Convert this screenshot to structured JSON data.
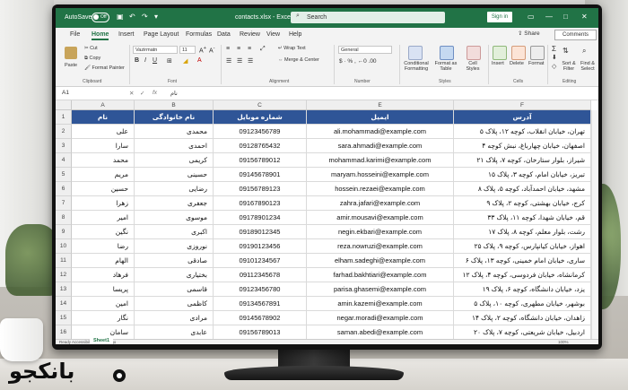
{
  "titlebar": {
    "autosave_label": "AutoSave",
    "autosave_state": "Off",
    "doc_title": "contacts.xlsx  -  Excel",
    "search_placeholder": "Search",
    "signin_label": "Sign in"
  },
  "menu": {
    "tabs": [
      "File",
      "Home",
      "Insert",
      "Page Layout",
      "Formulas",
      "Data",
      "Review",
      "View",
      "Help"
    ],
    "active": "Home",
    "share_label": "Share",
    "comments_label": "Comments"
  },
  "ribbon": {
    "clipboard": {
      "paste": "Paste",
      "cut": "Cut",
      "copy": "Copy",
      "format_painter": "Format Painter",
      "group": "Clipboard"
    },
    "font": {
      "name": "Vazirmatn",
      "size": "11",
      "group": "Font"
    },
    "alignment": {
      "wrap": "Wrap Text",
      "merge": "Merge & Center",
      "group": "Alignment"
    },
    "number": {
      "format": "General",
      "group": "Number"
    },
    "styles": {
      "conditional": "Conditional Formatting",
      "format_table": "Format as Table",
      "cell_styles": "Cell Styles",
      "group": "Styles"
    },
    "cells": {
      "insert": "Insert",
      "delete": "Delete",
      "format": "Format",
      "group": "Cells"
    },
    "editing": {
      "sort": "Sort & Filter",
      "find": "Find & Select",
      "group": "Editing"
    }
  },
  "formula_bar": {
    "cell_ref": "A1",
    "fx": "fx",
    "content": "نام"
  },
  "grid": {
    "columns": [
      "A",
      "B",
      "C",
      "D",
      "E",
      "F"
    ],
    "rows": [
      "1",
      "2",
      "3",
      "4",
      "5",
      "6",
      "7",
      "8",
      "9",
      "10",
      "11",
      "12",
      "13",
      "14",
      "15",
      "16"
    ],
    "header": [
      "نام",
      "نام خانوادگی",
      "شماره موبایل",
      "ایمیل",
      "آدرس"
    ],
    "data": [
      [
        "علی",
        "محمدی",
        "09123456789",
        "ali.mohammadi@example.com",
        "تهران، خیابان انقلاب، کوچه ۱۲، پلاک ۵"
      ],
      [
        "سارا",
        "احمدی",
        "09128765432",
        "sara.ahmadi@example.com",
        "اصفهان، خیابان چهارباغ، نبش کوچه ۴"
      ],
      [
        "محمد",
        "کریمی",
        "09156789012",
        "mohammad.karimi@example.com",
        "شیراز، بلوار ستارخان، کوچه ۷، پلاک ۲۱"
      ],
      [
        "مریم",
        "حسینی",
        "09145678901",
        "maryam.hosseini@example.com",
        "تبریز، خیابان امام، کوچه ۳، پلاک ۱۵"
      ],
      [
        "حسین",
        "رضایی",
        "09156789123",
        "hossein.rezaei@example.com",
        "مشهد، خیابان احمدآباد، کوچه ۵، پلاک ۸"
      ],
      [
        "زهرا",
        "جعفری",
        "09167890123",
        "zahra.jafari@example.com",
        "کرج، خیابان بهشتی، کوچه ۲، پلاک ۹"
      ],
      [
        "امیر",
        "موسوی",
        "09178901234",
        "amir.mousavi@example.com",
        "قم، خیابان شهدا، کوچه ۱۱، پلاک ۳۳"
      ],
      [
        "نگین",
        "اکبری",
        "09189012345",
        "negin.ekbari@example.com",
        "رشت، بلوار معلم، کوچه ۸، پلاک ۱۷"
      ],
      [
        "رضا",
        "نوروزی",
        "09190123456",
        "reza.nowruzi@example.com",
        "اهواز، خیابان کیانپارس، کوچه ۹، پلاک ۲۵"
      ],
      [
        "الهام",
        "صادقی",
        "09101234567",
        "elham.sadeghi@example.com",
        "ساری، خیابان امام خمینی، کوچه ۱۳، پلاک ۶"
      ],
      [
        "فرهاد",
        "بختیاری",
        "09112345678",
        "farhad.bakhtiari@example.com",
        "کرمانشاه، خیابان فردوسی، کوچه ۴، پلاک ۱۲"
      ],
      [
        "پریسا",
        "قاسمی",
        "09123456780",
        "parisa.ghasemi@example.com",
        "یزد، خیابان دانشگاه، کوچه ۶، پلاک ۱۹"
      ],
      [
        "امین",
        "کاظمی",
        "09134567891",
        "amin.kazemi@example.com",
        "بوشهر، خیابان مطهری، کوچه ۱۰، پلاک ۵"
      ],
      [
        "نگار",
        "مرادی",
        "09145678902",
        "negar.moradi@example.com",
        "زاهدان، خیابان دانشگاه، کوچه ۲، پلاک ۱۴"
      ],
      [
        "سامان",
        "عابدی",
        "09156789013",
        "saman.abedi@example.com",
        "اردبیل، خیابان شریعتی، کوچه ۷، پلاک ۲۰"
      ]
    ]
  },
  "bottom": {
    "sheet_tab": "Sheet1",
    "status_left": "Ready  Accessibility: Good to go",
    "zoom": "100%"
  },
  "watermark": {
    "text": "بانکجو"
  },
  "colors": {
    "excel_green": "#217346",
    "header_blue": "#2f5597"
  }
}
